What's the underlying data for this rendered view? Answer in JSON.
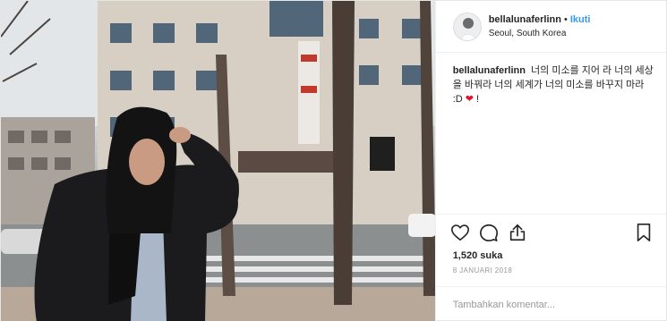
{
  "post": {
    "username": "bellalunaferlinn",
    "separator": "•",
    "follow_label": "Ikuti",
    "location": "Seoul, South Korea",
    "caption_text": "너의 미소를 지어 라 너의 세상을 바꿔라 너의 세계가 너의 미소를 바꾸지 마라 :D",
    "caption_emoji": "❤",
    "caption_tail": " !",
    "likes": "1,520 suka",
    "date": "8 JANUARI 2018",
    "comment_placeholder": "Tambahkan komentar..."
  },
  "icons": {
    "like": "heart-icon",
    "comment": "comment-icon",
    "share": "share-icon",
    "save": "bookmark-icon"
  },
  "colors": {
    "link": "#3897f0",
    "text": "#262626",
    "muted": "#999999",
    "emoji_heart": "#e0142e"
  }
}
